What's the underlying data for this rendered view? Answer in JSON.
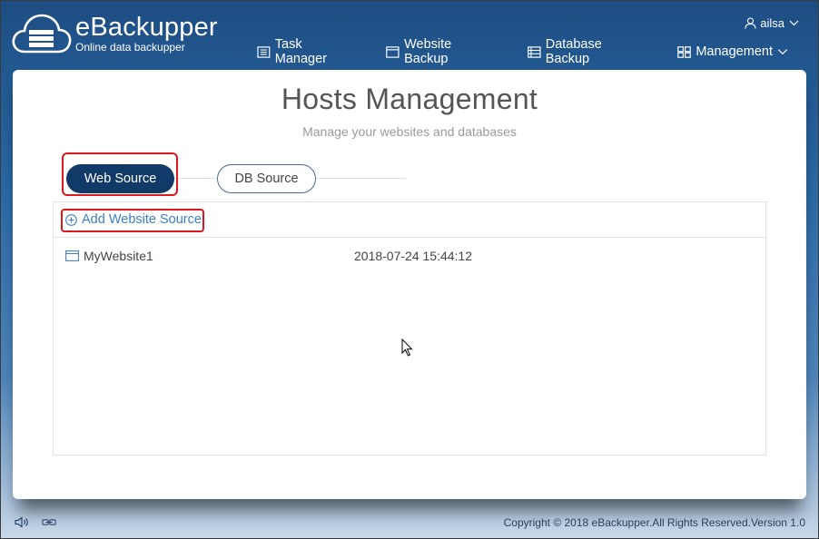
{
  "app": {
    "name": "eBackupper",
    "tagline": "Online data backupper"
  },
  "user": {
    "name": "ailsa"
  },
  "nav": {
    "items": [
      {
        "label": "Task Manager",
        "icon": "task-list-icon"
      },
      {
        "label": "Website Backup",
        "icon": "website-icon"
      },
      {
        "label": "Database Backup",
        "icon": "database-icon"
      },
      {
        "label": "Management",
        "icon": "grid-icon"
      }
    ]
  },
  "page": {
    "title": "Hosts Management",
    "subtitle": "Manage your websites and databases"
  },
  "tabs": {
    "web": "Web Source",
    "db": "DB Source",
    "active": "web"
  },
  "actions": {
    "add_website": "Add Website Source"
  },
  "sites": [
    {
      "name": "MyWebsite1",
      "date": "2018-07-24 15:44:12"
    }
  ],
  "footer": {
    "copyright": "Copyright © 2018 eBackupper.All Rights Reserved.Version 1.0"
  },
  "colors": {
    "highlight": "#e0161e",
    "active_tab": "#123a69",
    "link": "#3c7fc6"
  }
}
